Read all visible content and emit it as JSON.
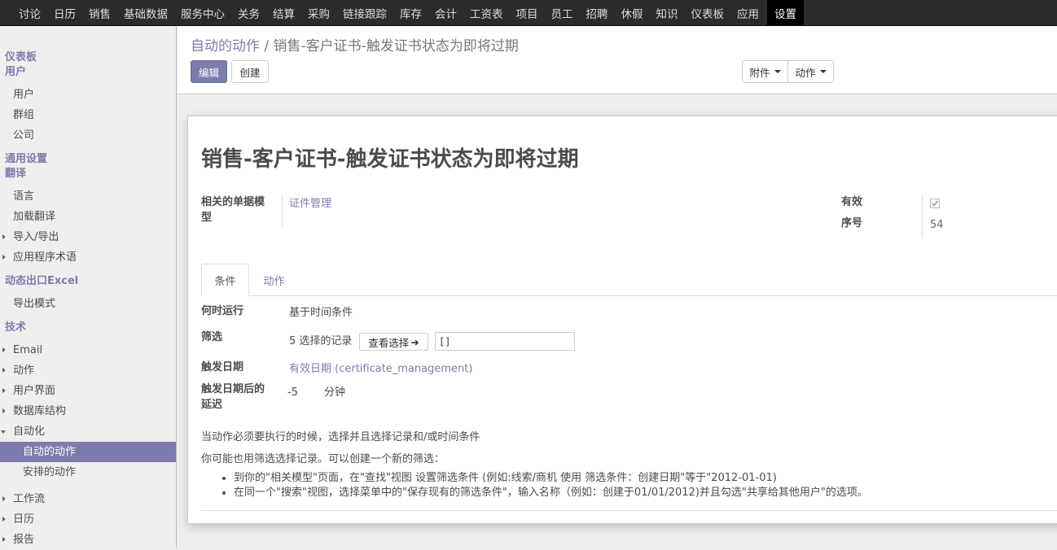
{
  "topnav": [
    "讨论",
    "日历",
    "销售",
    "基础数据",
    "服务中心",
    "关务",
    "结算",
    "采购",
    "链接跟踪",
    "库存",
    "会计",
    "工资表",
    "项目",
    "员工",
    "招聘",
    "休假",
    "知识",
    "仪表板",
    "应用"
  ],
  "topnav_active": "设置",
  "sidebar": {
    "dashboard": "仪表板",
    "users_head": "用户",
    "users_items": [
      "用户",
      "群组",
      "公司"
    ],
    "general_head": "通用设置",
    "translate_head": "翻译",
    "translate_items": [
      "语言",
      "加载翻译"
    ],
    "translate_caret_items": [
      "导入/导出",
      "应用程序术语"
    ],
    "excel_head": "动态出口Excel",
    "excel_items": [
      "导出模式"
    ],
    "tech_head": "技术",
    "tech_caret_items": [
      "Email",
      "动作",
      "用户界面",
      "数据库结构"
    ],
    "automation": "自动化",
    "automation_sub": [
      "自动的动作",
      "安排的动作"
    ],
    "after_items": [
      "工作流",
      "日历",
      "报告"
    ]
  },
  "breadcrumb": {
    "parent": "自动的动作",
    "sep": "/",
    "current": "销售-客户证书-触发证书状态为即将过期"
  },
  "buttons": {
    "edit": "编辑",
    "create": "创建",
    "attachment": "附件",
    "action": "动作"
  },
  "form": {
    "title": "销售-客户证书-触发证书状态为即将过期",
    "model_label": "相关的单据模型",
    "model_value": "证件管理",
    "active_label": "有效",
    "active_checked": true,
    "seq_label": "序号",
    "seq_value": "54",
    "tabs": [
      "条件",
      "动作"
    ],
    "when_label": "何时运行",
    "when_value": "基于时间条件",
    "filter_label": "筛选",
    "filter_count": "5 选择的记录",
    "filter_button": "查看选择",
    "filter_domain": "[]",
    "trigger_label": "触发日期",
    "trigger_value": "有效日期 (certificate_management)",
    "delay_label": "触发日期后的延迟",
    "delay_value": "-5",
    "delay_unit": "分钟",
    "help1": "当动作必须要执行的时候，选择并且选择记录和/或时间条件",
    "help2": "你可能也用筛选选择记录。可以创建一个新的筛选：",
    "bullet1": "到你的\"相关模型\"页面，在\"查找\"视图 设置筛选条件 (例如:线索/商机 使用 筛选条件：创建日期\"等于\"2012-01-01)",
    "bullet2": "在同一个\"搜索\"视图，选择菜单中的\"保存现有的筛选条件\"，输入名称（例如：创建于01/01/2012)并且勾选\"共享给其他用户\"的选项。"
  }
}
